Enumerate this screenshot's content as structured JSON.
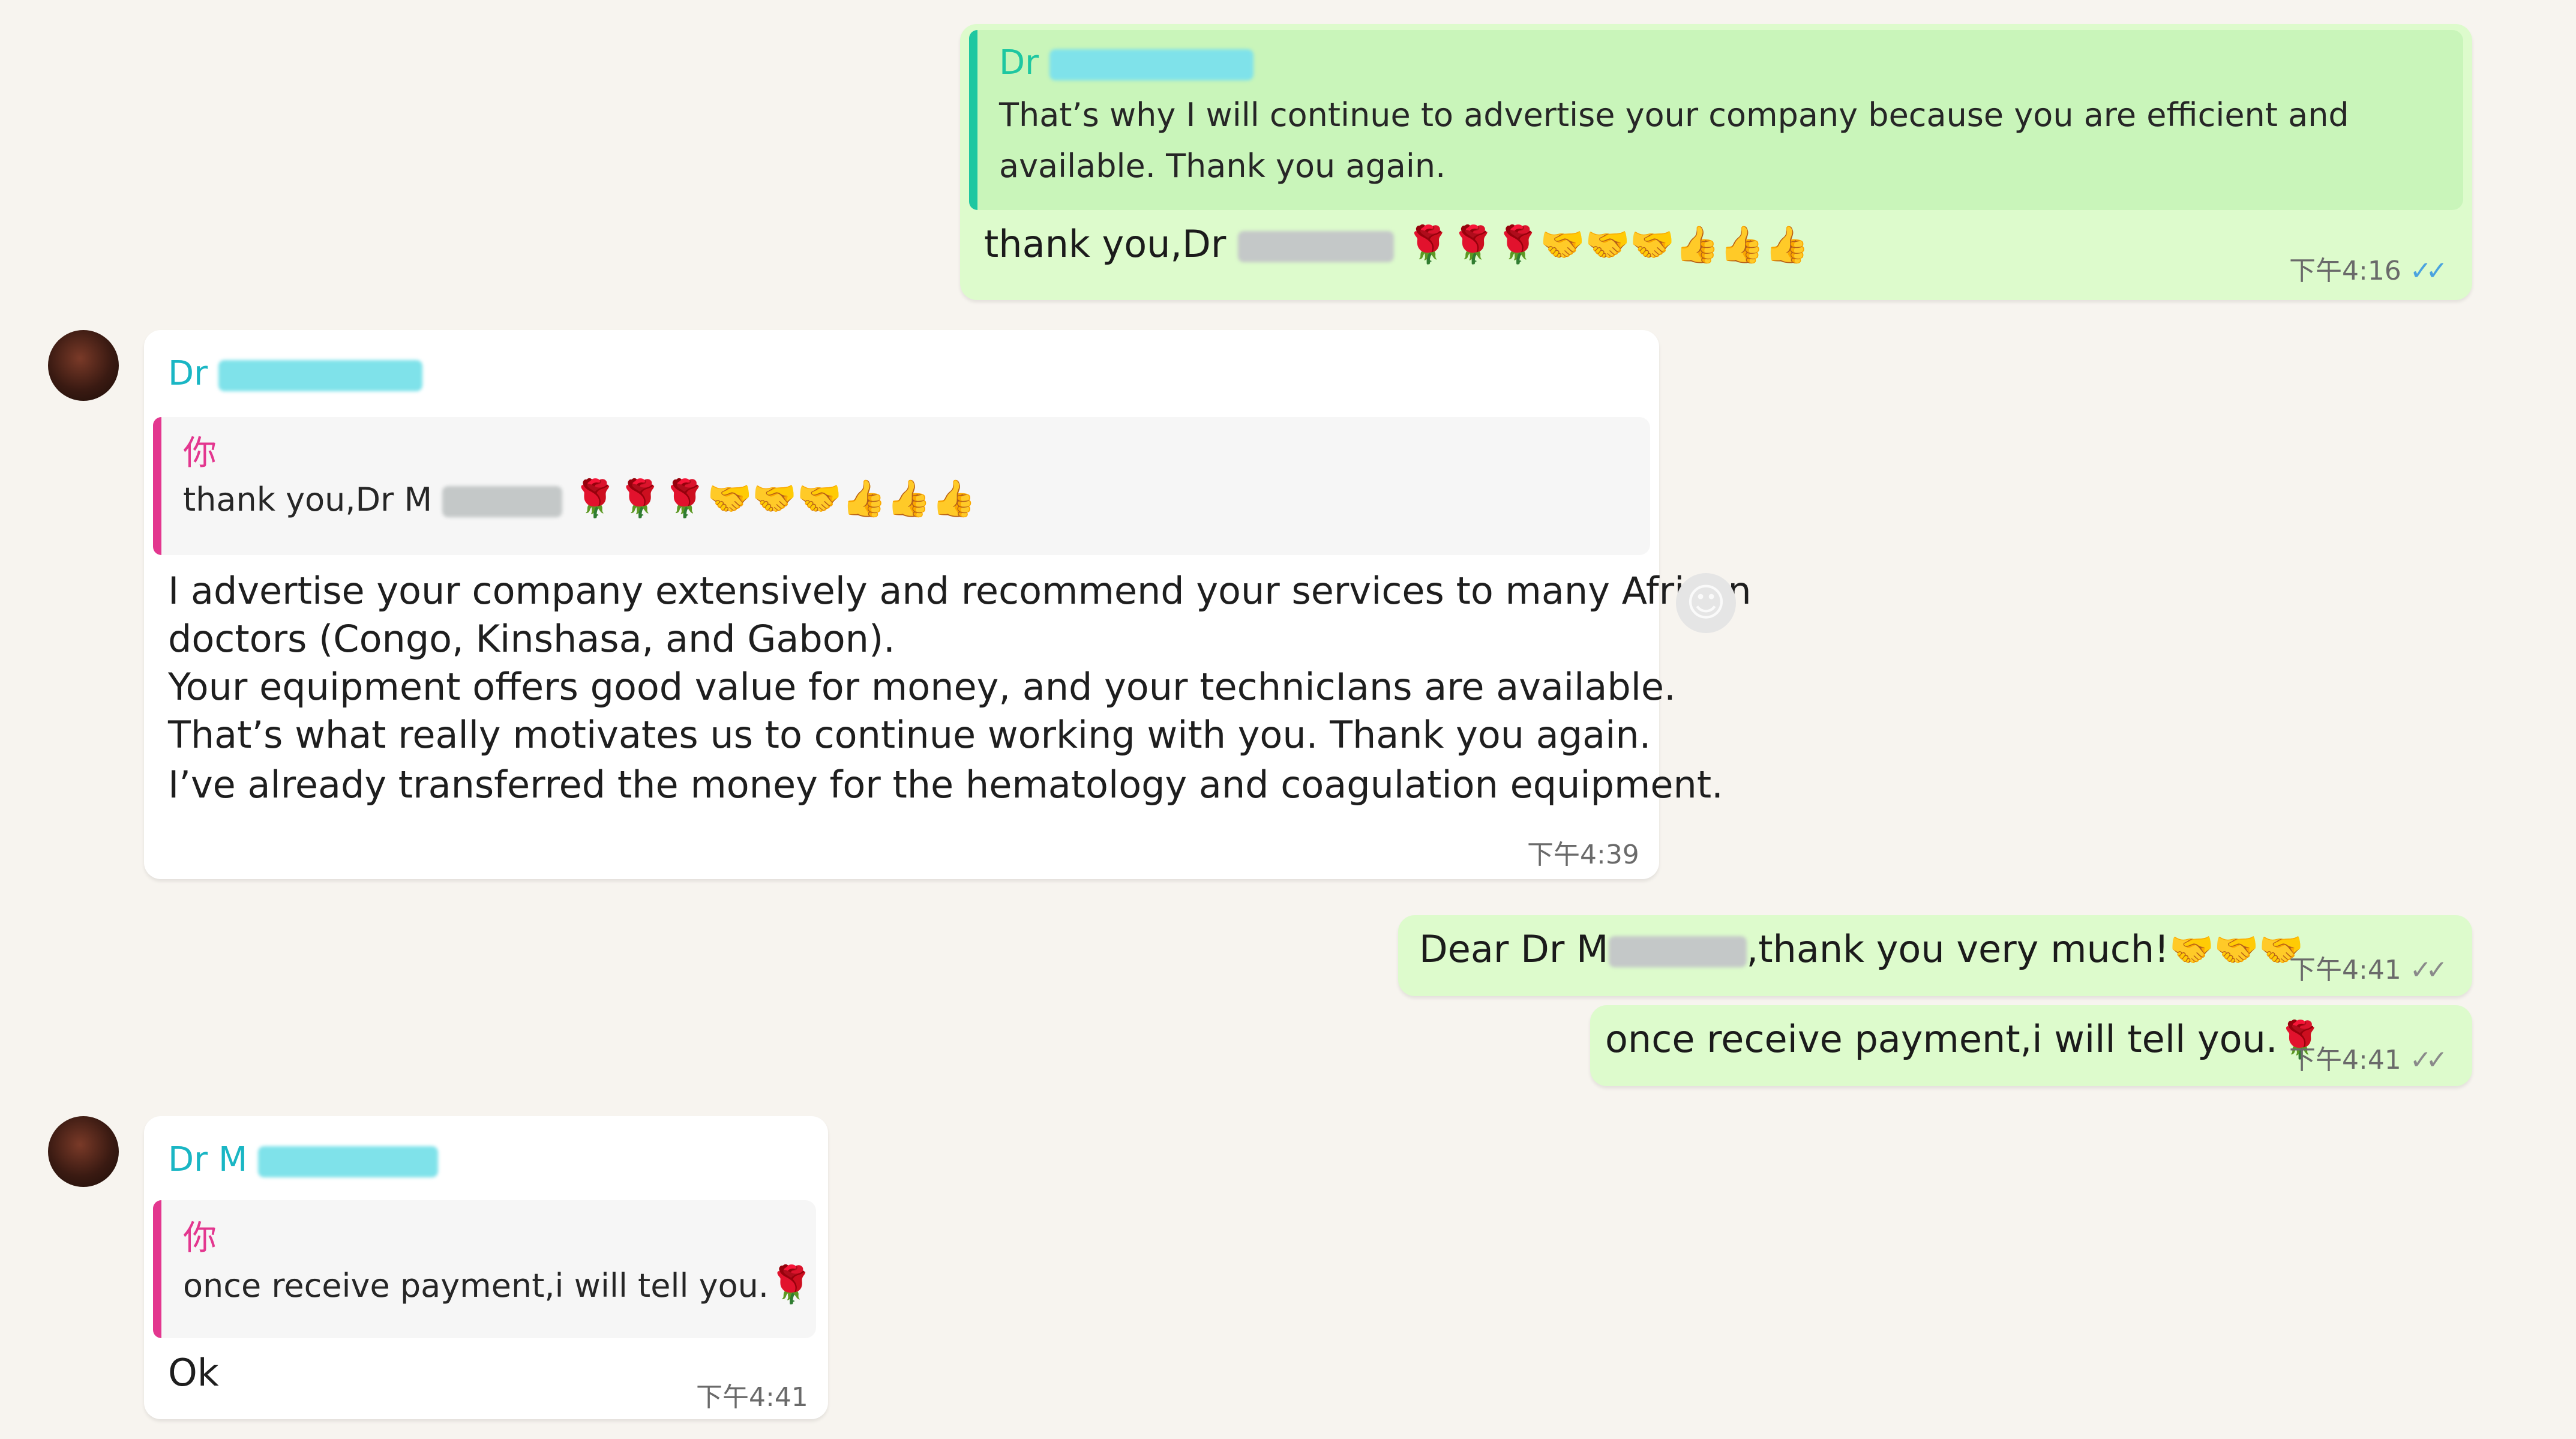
{
  "messages": [
    {
      "id": "m1",
      "direction": "out",
      "quote": {
        "sender": "Dr",
        "lines": [
          "That’s why I will continue to advertise your company because you are efficient and",
          "available. Thank you again."
        ]
      },
      "text_prefix": "thank you,Dr",
      "emojis": "🌹🌹🌹🤝🤝🤝👍👍👍",
      "time": "下午4:16",
      "ticks": "✓✓"
    },
    {
      "id": "m2",
      "direction": "in",
      "sender": "Dr",
      "quote": {
        "sender": "你",
        "text_prefix": "thank you,Dr M",
        "emojis": "🌹🌹🌹🤝🤝🤝👍👍👍"
      },
      "lines": [
        "I advertise your company extensively and recommend your services to many African",
        "doctors (Congo, Kinshasa, and Gabon).",
        "Your equipment offers good value for money, and your technicIans are available.",
        "That’s what really motivates us to continue working with you. Thank you again.",
        "I’ve already transferred the money for the hematology and coagulation equipment."
      ],
      "time": "下午4:39"
    },
    {
      "id": "m3",
      "direction": "out",
      "text_prefix": "Dear Dr M",
      "text_suffix": ",thank you very much!",
      "emojis": "🤝🤝🤝",
      "time": "下午4:41",
      "ticks": "✓✓"
    },
    {
      "id": "m4",
      "direction": "out",
      "text": "once receive payment,i will tell you.",
      "emojis": "🌹",
      "time": "下午4:41",
      "ticks": "✓✓"
    },
    {
      "id": "m5",
      "direction": "in",
      "sender": "Dr M",
      "quote": {
        "sender": "你",
        "text": "once receive payment,i will tell you.",
        "emojis": "🌹"
      },
      "text": "Ok",
      "time": "下午4:41"
    }
  ],
  "icons": {
    "reaction": "emoji-reaction-icon",
    "avatar": "contact-avatar-icon",
    "ticks": "double-check-icon"
  },
  "colors": {
    "outgoing_bubble": "#ddfbcc",
    "incoming_bubble": "#ffffff",
    "sender_name": "#1ab6c4",
    "quote_bar_teal": "#1ec7a1",
    "quote_bar_pink": "#e3378f",
    "read_ticks": "#4aa3df"
  }
}
